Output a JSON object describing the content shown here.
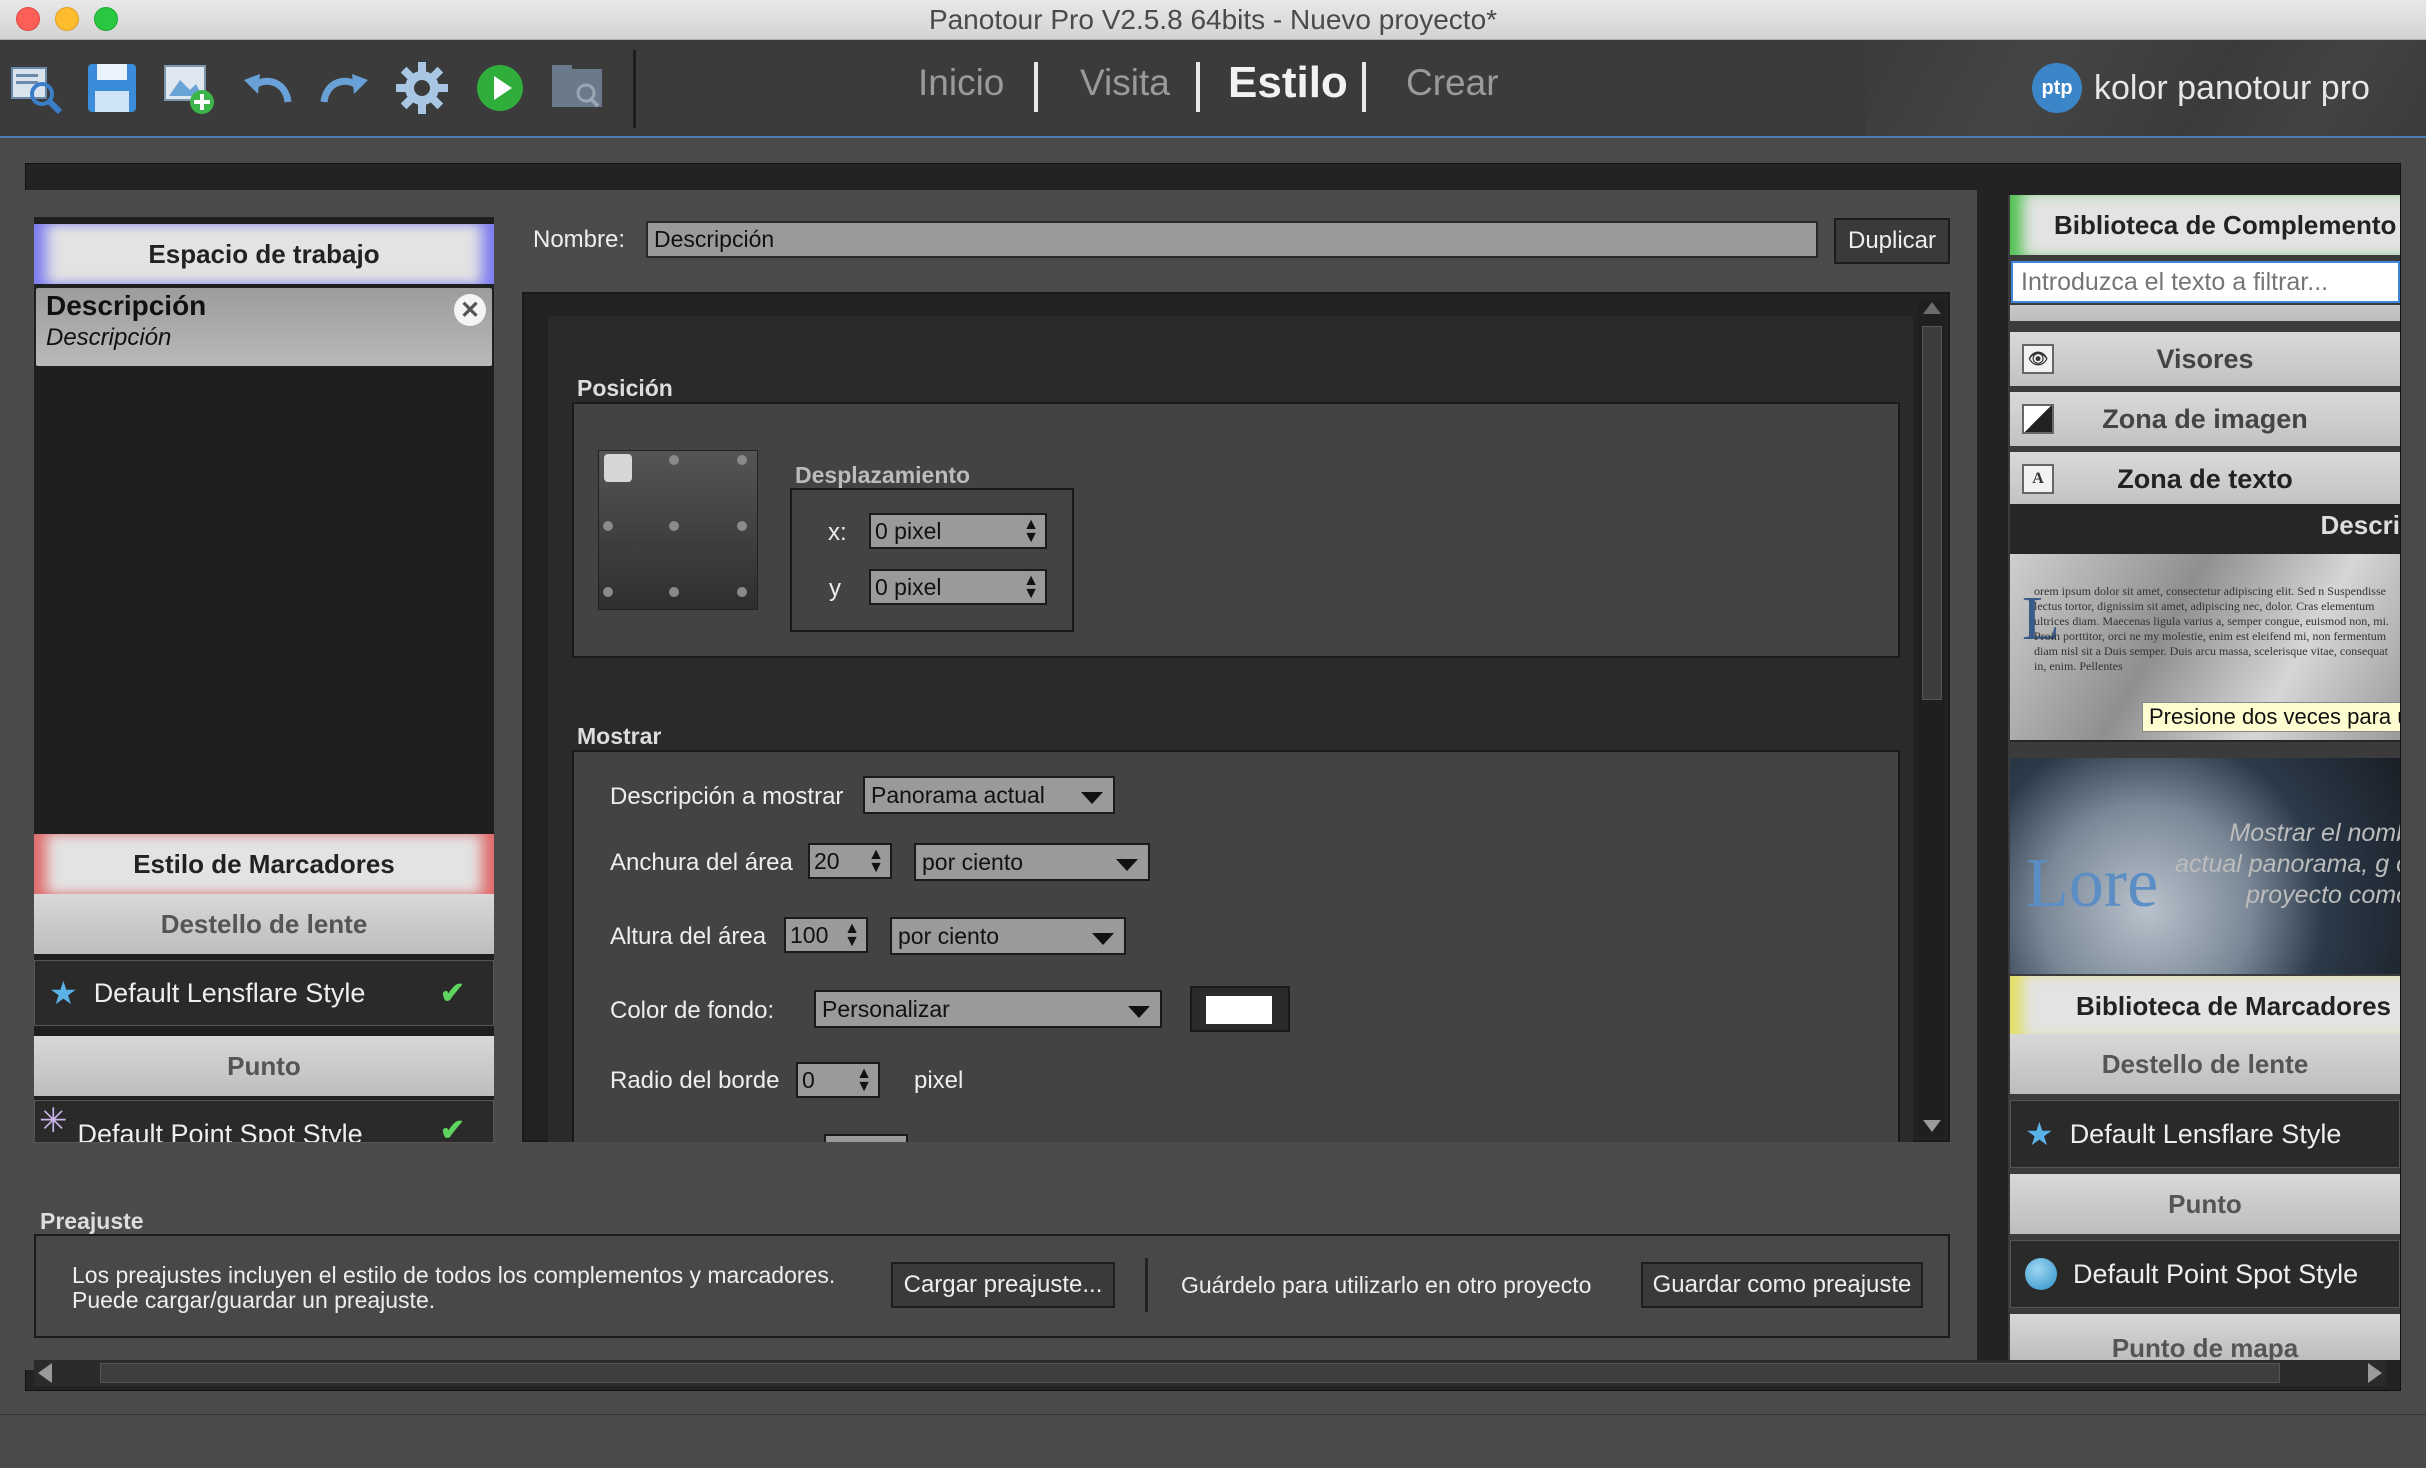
{
  "window": {
    "title": "Panotour Pro V2.5.8 64bits - Nuevo proyecto*"
  },
  "toolbar": {
    "icons": [
      "open-project-icon",
      "save-icon",
      "add-panorama-icon",
      "undo-icon",
      "redo-icon",
      "settings-gear-icon",
      "play-icon",
      "preview-folder-icon"
    ],
    "tabs": [
      {
        "label": "Inicio"
      },
      {
        "label": "Visita"
      },
      {
        "label": "Estilo"
      },
      {
        "label": "Crear"
      }
    ],
    "active_tab": "Estilo",
    "brand": {
      "badge": "ptp",
      "text": "kolor panotour pro"
    }
  },
  "left": {
    "workspace_header": "Espacio de trabajo",
    "workspace_item": {
      "title": "Descripción",
      "subtitle": "Descripción"
    },
    "markers_header": "Estilo de Marcadores",
    "lensflare_header": "Destello de lente",
    "lensflare_item": "Default Lensflare Style",
    "point_header": "Punto",
    "point_item": "Default Point Spot Style"
  },
  "form": {
    "name_label": "Nombre:",
    "name_value": "Descripción",
    "duplicate_button": "Duplicar",
    "position_title": "Posición",
    "offset_title": "Desplazamiento",
    "x_label": "x:",
    "x_value": "0 pixel",
    "y_label": "y",
    "y_value": "0 pixel",
    "show_title": "Mostrar",
    "desc_label": "Descripción a mostrar",
    "desc_value": "Panorama actual",
    "width_label": "Anchura del área",
    "width_value": "20",
    "width_unit": "por ciento",
    "height_label": "Altura del área",
    "height_value": "100",
    "height_unit": "por ciento",
    "bg_label": "Color de fondo:",
    "bg_value": "Personalizar",
    "bg_color": "#ffffff",
    "radius_label": "Radio del borde",
    "radius_value": "0",
    "radius_unit": "pixel"
  },
  "right": {
    "lib_header": "Biblioteca de Complemento",
    "filter_placeholder": "Introduzca el texto a filtrar...",
    "items": [
      {
        "label": "Visores",
        "icon": "eye-icon"
      },
      {
        "label": "Zona de imagen",
        "icon": "image-zone-icon"
      },
      {
        "label": "Zona de texto",
        "icon": "text-zone-icon"
      }
    ],
    "preview_title": "Descri",
    "tooltip": "Presione dos veces para us",
    "preview2_text": "Mostrar el nomb actual panorama, g o proyecto como",
    "preview2_big": "Lore",
    "markers_header": "Biblioteca de Marcadores",
    "lensflare_header": "Destello de lente",
    "lensflare_item": "Default Lensflare Style",
    "point_header": "Punto",
    "point_item": "Default Point Spot Style",
    "map_point_header": "Punto de mapa"
  },
  "preset": {
    "title": "Preajuste",
    "info_line1": "Los preajustes incluyen el estilo de todos los complementos y marcadores.",
    "info_line2": "Puede cargar/guardar un preajuste.",
    "load_button": "Cargar preajuste...",
    "save_hint": "Guárdelo para utilizarlo en otro proyecto",
    "save_button": "Guardar como preajuste"
  },
  "colors": {
    "accent": "#4d7fb0",
    "check": "#5ed35e"
  }
}
